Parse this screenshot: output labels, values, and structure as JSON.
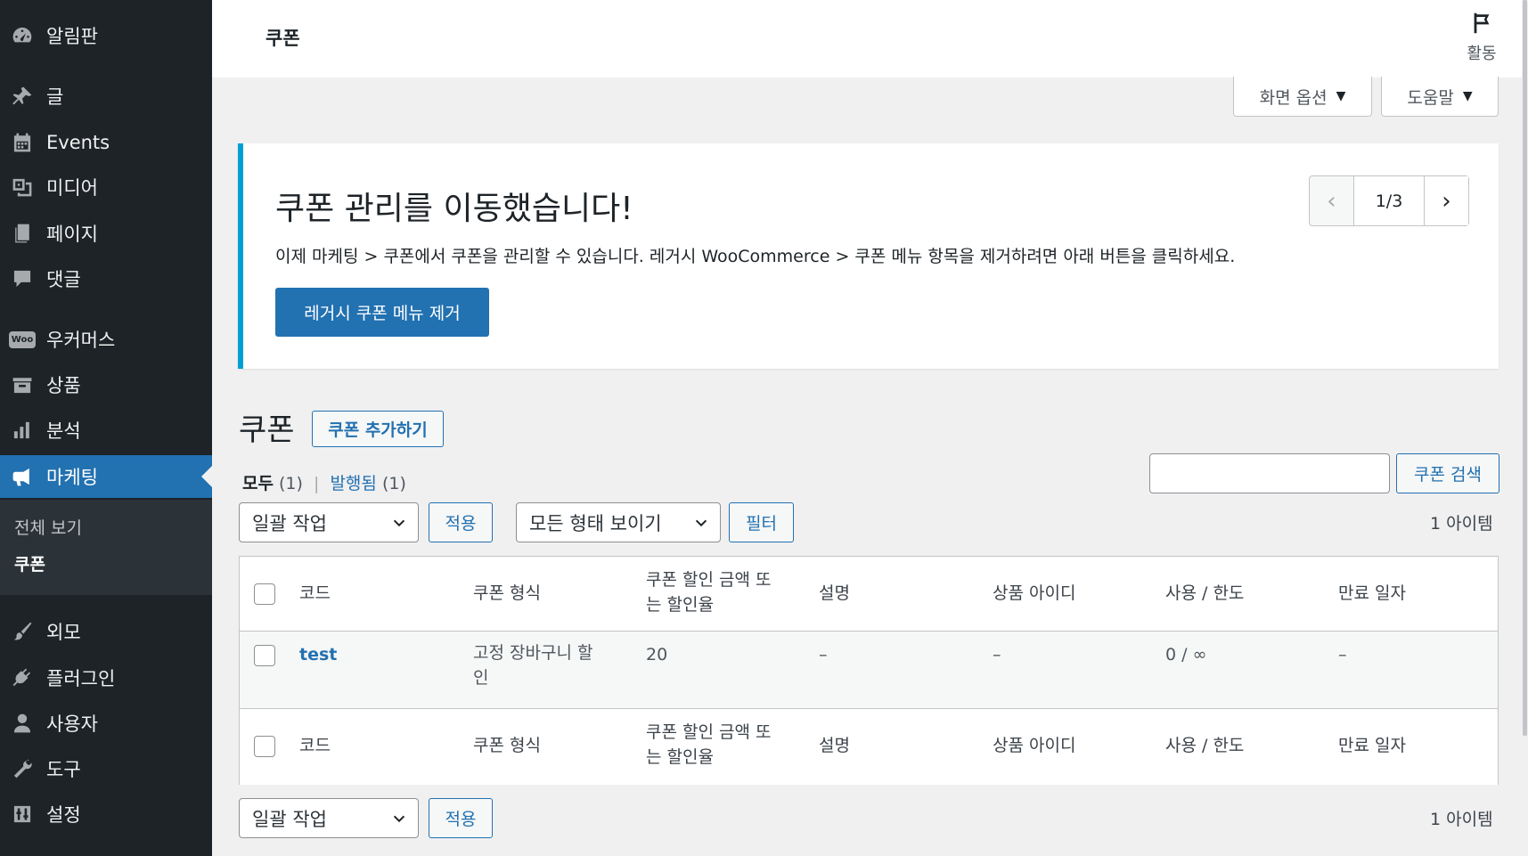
{
  "sidebar": {
    "items": [
      {
        "label": "알림판",
        "icon": "dashboard-icon"
      },
      {
        "label": "글",
        "icon": "pushpin-icon"
      },
      {
        "label": "Events",
        "icon": "calendar-icon"
      },
      {
        "label": "미디어",
        "icon": "media-icon"
      },
      {
        "label": "페이지",
        "icon": "page-icon"
      },
      {
        "label": "댓글",
        "icon": "comment-icon"
      },
      {
        "label": "우커머스",
        "icon": "woo-icon"
      },
      {
        "label": "상품",
        "icon": "archive-icon"
      },
      {
        "label": "분석",
        "icon": "bar-chart-icon"
      },
      {
        "label": "마케팅",
        "icon": "megaphone-icon"
      },
      {
        "label": "외모",
        "icon": "brush-icon"
      },
      {
        "label": "플러그인",
        "icon": "plugin-icon"
      },
      {
        "label": "사용자",
        "icon": "user-icon"
      },
      {
        "label": "도구",
        "icon": "wrench-icon"
      },
      {
        "label": "설정",
        "icon": "settings-icon"
      }
    ],
    "woo_badge": "Woo",
    "submenu": [
      {
        "label": "전체 보기"
      },
      {
        "label": "쿠폰"
      }
    ]
  },
  "header": {
    "title": "쿠폰",
    "activity_label": "활동"
  },
  "screen_meta": {
    "screen_options": "화면 옵션",
    "help": "도움말"
  },
  "notice": {
    "title": "쿠폰 관리를 이동했습니다!",
    "text": "이제 마케팅 > 쿠폰에서 쿠폰을 관리할 수 있습니다. 레거시 WooCommerce > 쿠폰 메뉴 항목을 제거하려면 아래 버튼을 클릭하세요.",
    "button": "레거시 쿠폰 메뉴 제거",
    "pager": "1/3"
  },
  "page": {
    "title": "쿠폰",
    "add_button": "쿠폰 추가하기"
  },
  "views": {
    "all_label": "모두",
    "all_count": "(1)",
    "separator": "|",
    "published_label": "발행됨",
    "published_count": "(1)"
  },
  "search": {
    "value": "",
    "button": "쿠폰 검색"
  },
  "tablenav": {
    "bulk_action": "일괄 작업",
    "apply": "적용",
    "type_filter": "모든 형태 보이기",
    "filter": "필터",
    "items_count": "1 아이템"
  },
  "table": {
    "columns": [
      "코드",
      "쿠폰 형식",
      "쿠폰 할인 금액 또는 할인율",
      "설명",
      "상품 아이디",
      "사용 / 한도",
      "만료 일자"
    ],
    "column_discount_lines": [
      "쿠폰 할인 금액 또",
      "는 할인율"
    ],
    "rows": [
      {
        "code": "test",
        "type_lines": [
          "고정 장바구니 할",
          "인"
        ],
        "amount": "20",
        "description": "–",
        "product_ids": "–",
        "usage": "0 / ∞",
        "expiry": "–"
      }
    ]
  }
}
